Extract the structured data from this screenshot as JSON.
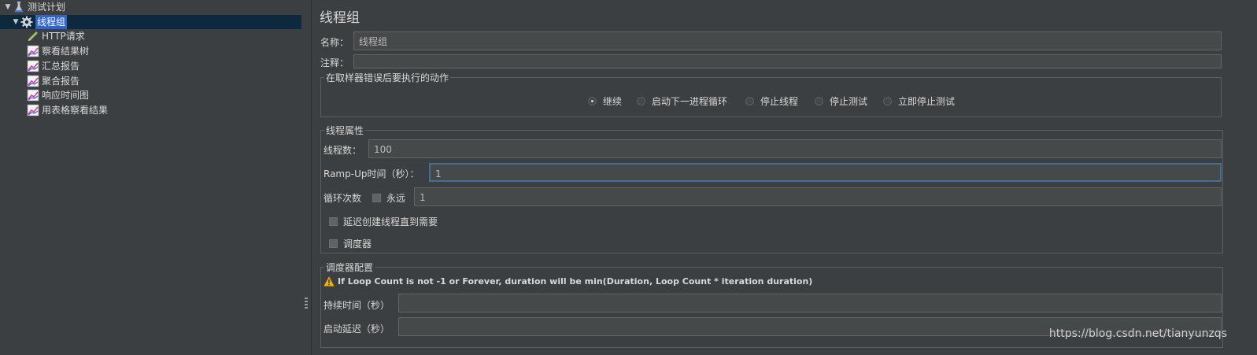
{
  "tree": {
    "root_label": "测试计划",
    "thread_group_label": "线程组",
    "children": [
      "HTTP请求",
      "察看结果树",
      "汇总报告",
      "聚合报告",
      "响应时间图",
      "用表格察看结果"
    ]
  },
  "panel": {
    "title": "线程组",
    "name_label": "名称：",
    "name_value": "线程组",
    "comment_label": "注释：",
    "comment_value": ""
  },
  "error_action": {
    "title": "在取样器错误后要执行的动作",
    "options": [
      "继续",
      "启动下一进程循环",
      "停止线程",
      "停止测试",
      "立即停止测试"
    ],
    "selected": "继续"
  },
  "thread_props": {
    "title": "线程属性",
    "threads_label": "线程数：",
    "threads_value": "100",
    "rampup_label": "Ramp-Up时间（秒）：",
    "rampup_value": "1",
    "loop_label": "循环次数",
    "forever_label": "永远",
    "loop_value": "1",
    "delay_label": "延迟创建线程直到需要",
    "scheduler_label": "调度器"
  },
  "scheduler_config": {
    "title": "调度器配置",
    "warning": "If Loop Count is not -1 or Forever, duration will be min(Duration, Loop Count * iteration duration)",
    "duration_label": "持续时间（秒）",
    "duration_value": "",
    "delay_label": "启动延迟（秒）",
    "delay_value": ""
  },
  "watermark": "https://blog.csdn.net/tianyunzqs",
  "colors": {
    "background": "#3c3f41",
    "selection": "#2f65ca",
    "field": "#45494a",
    "focus_border": "#466d94"
  },
  "icons": [
    "flask-icon",
    "gear-icon",
    "pen-icon",
    "graph-icon",
    "warning-icon"
  ]
}
